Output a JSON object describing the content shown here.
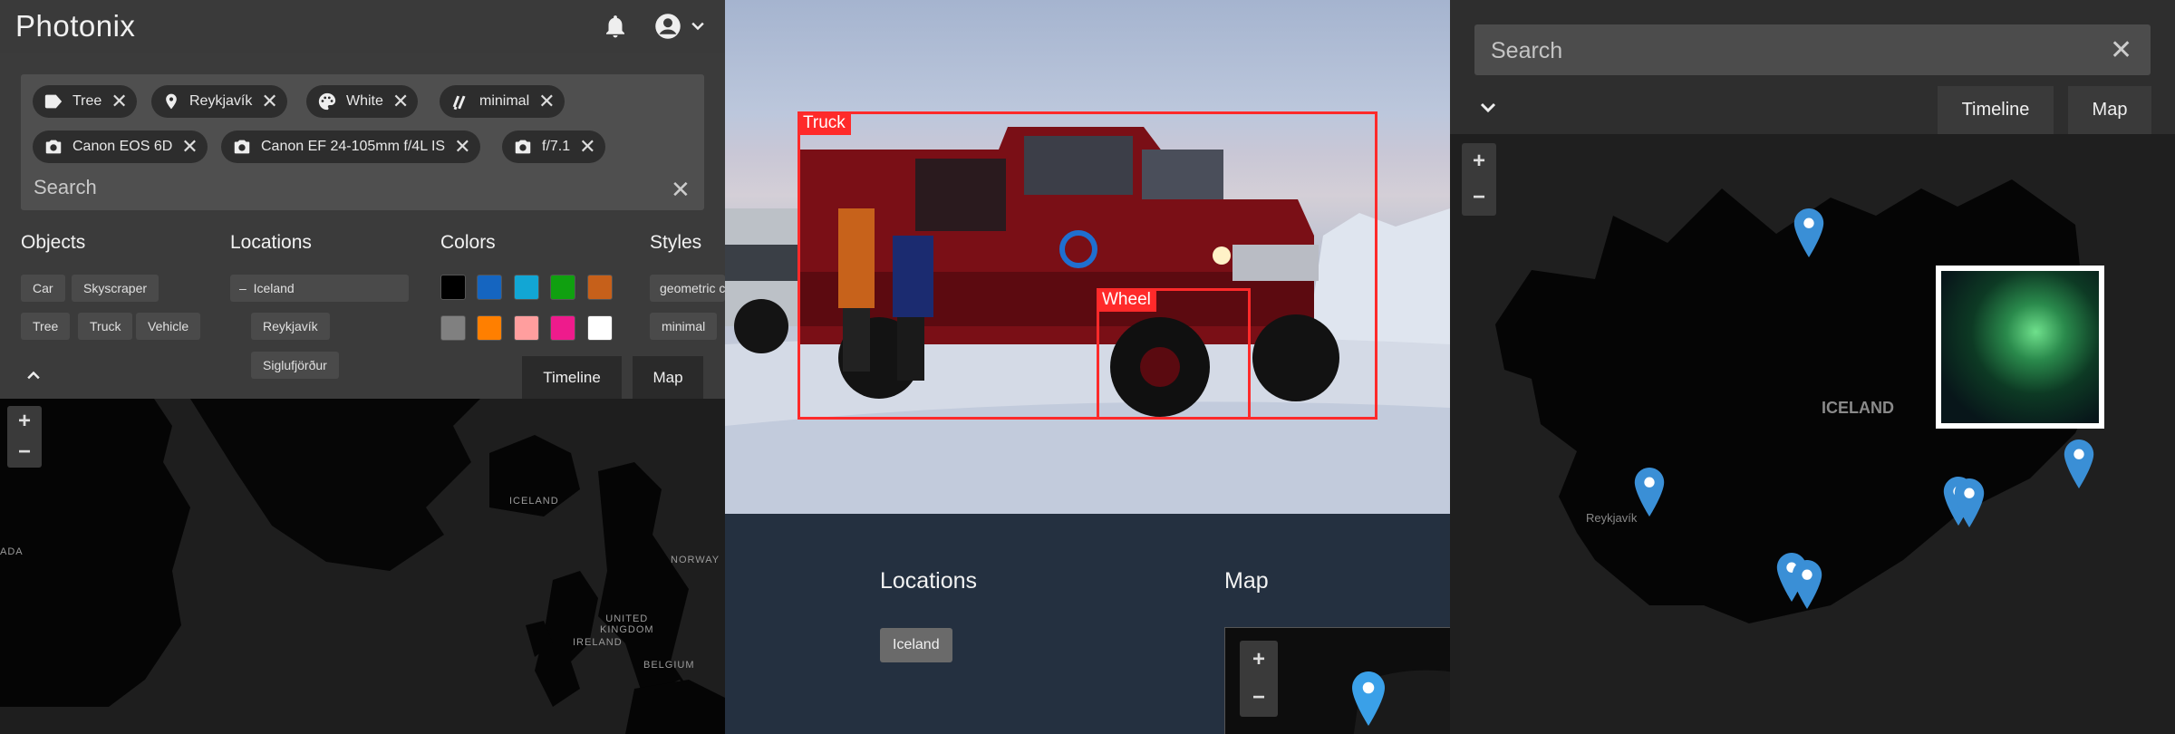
{
  "app": {
    "title": "Photonix"
  },
  "filters": {
    "chips": [
      {
        "label": "Tree",
        "icon": "tag-icon"
      },
      {
        "label": "Reykjavík",
        "icon": "location-pin-icon"
      },
      {
        "label": "White",
        "icon": "palette-icon"
      },
      {
        "label": "minimal",
        "icon": "style-icon"
      },
      {
        "label": "Canon EOS 6D",
        "icon": "camera-icon"
      },
      {
        "label": "Canon EF 24-105mm f/4L IS",
        "icon": "camera-icon"
      },
      {
        "label": "f/7.1",
        "icon": "camera-icon"
      }
    ],
    "search_placeholder": "Search"
  },
  "columns": {
    "objects": {
      "title": "Objects",
      "items": [
        "Car",
        "Skyscraper",
        "Tree",
        "Truck",
        "Vehicle"
      ]
    },
    "locations": {
      "title": "Locations",
      "parent": "Iceland",
      "parent_toggle": "–",
      "children": [
        "Reykjavík",
        "Siglufjörður"
      ]
    },
    "colors": {
      "title": "Colors",
      "swatches": [
        "#000000",
        "#1565c0",
        "#12a6d4",
        "#10a010",
        "#c6601a",
        "#808080",
        "#ff7f00",
        "#ff9e9e",
        "#ee1b8c",
        "#ffffff"
      ]
    },
    "styles": {
      "title": "Styles",
      "items": [
        "geometric composition",
        "minimal"
      ]
    }
  },
  "tabs": {
    "timeline": "Timeline",
    "map": "Map"
  },
  "world_map": {
    "labels": {
      "iceland": "ICELAND",
      "norway": "NORWAY",
      "united_kingdom": "UNITED\nKINGDOM",
      "ireland": "IRELAND",
      "belgium": "BELGIUM",
      "canada": "ADA"
    },
    "zoom_in": "+",
    "zoom_out": "−"
  },
  "detail": {
    "boxes": [
      {
        "label": "Truck"
      },
      {
        "label": "Wheel"
      }
    ],
    "locations_title": "Locations",
    "location_tag": "Iceland",
    "map_title": "Map",
    "mini_zoom_in": "+",
    "mini_zoom_out": "−"
  },
  "map_view": {
    "search_placeholder": "Search",
    "country_label": "ICELAND",
    "city_label": "Reykjavík",
    "zoom_in": "+",
    "zoom_out": "−",
    "pin_color": "#3a8fd6"
  },
  "colors": {
    "accent_box": "#ff2a2a",
    "pin": "#3a8fd6"
  }
}
